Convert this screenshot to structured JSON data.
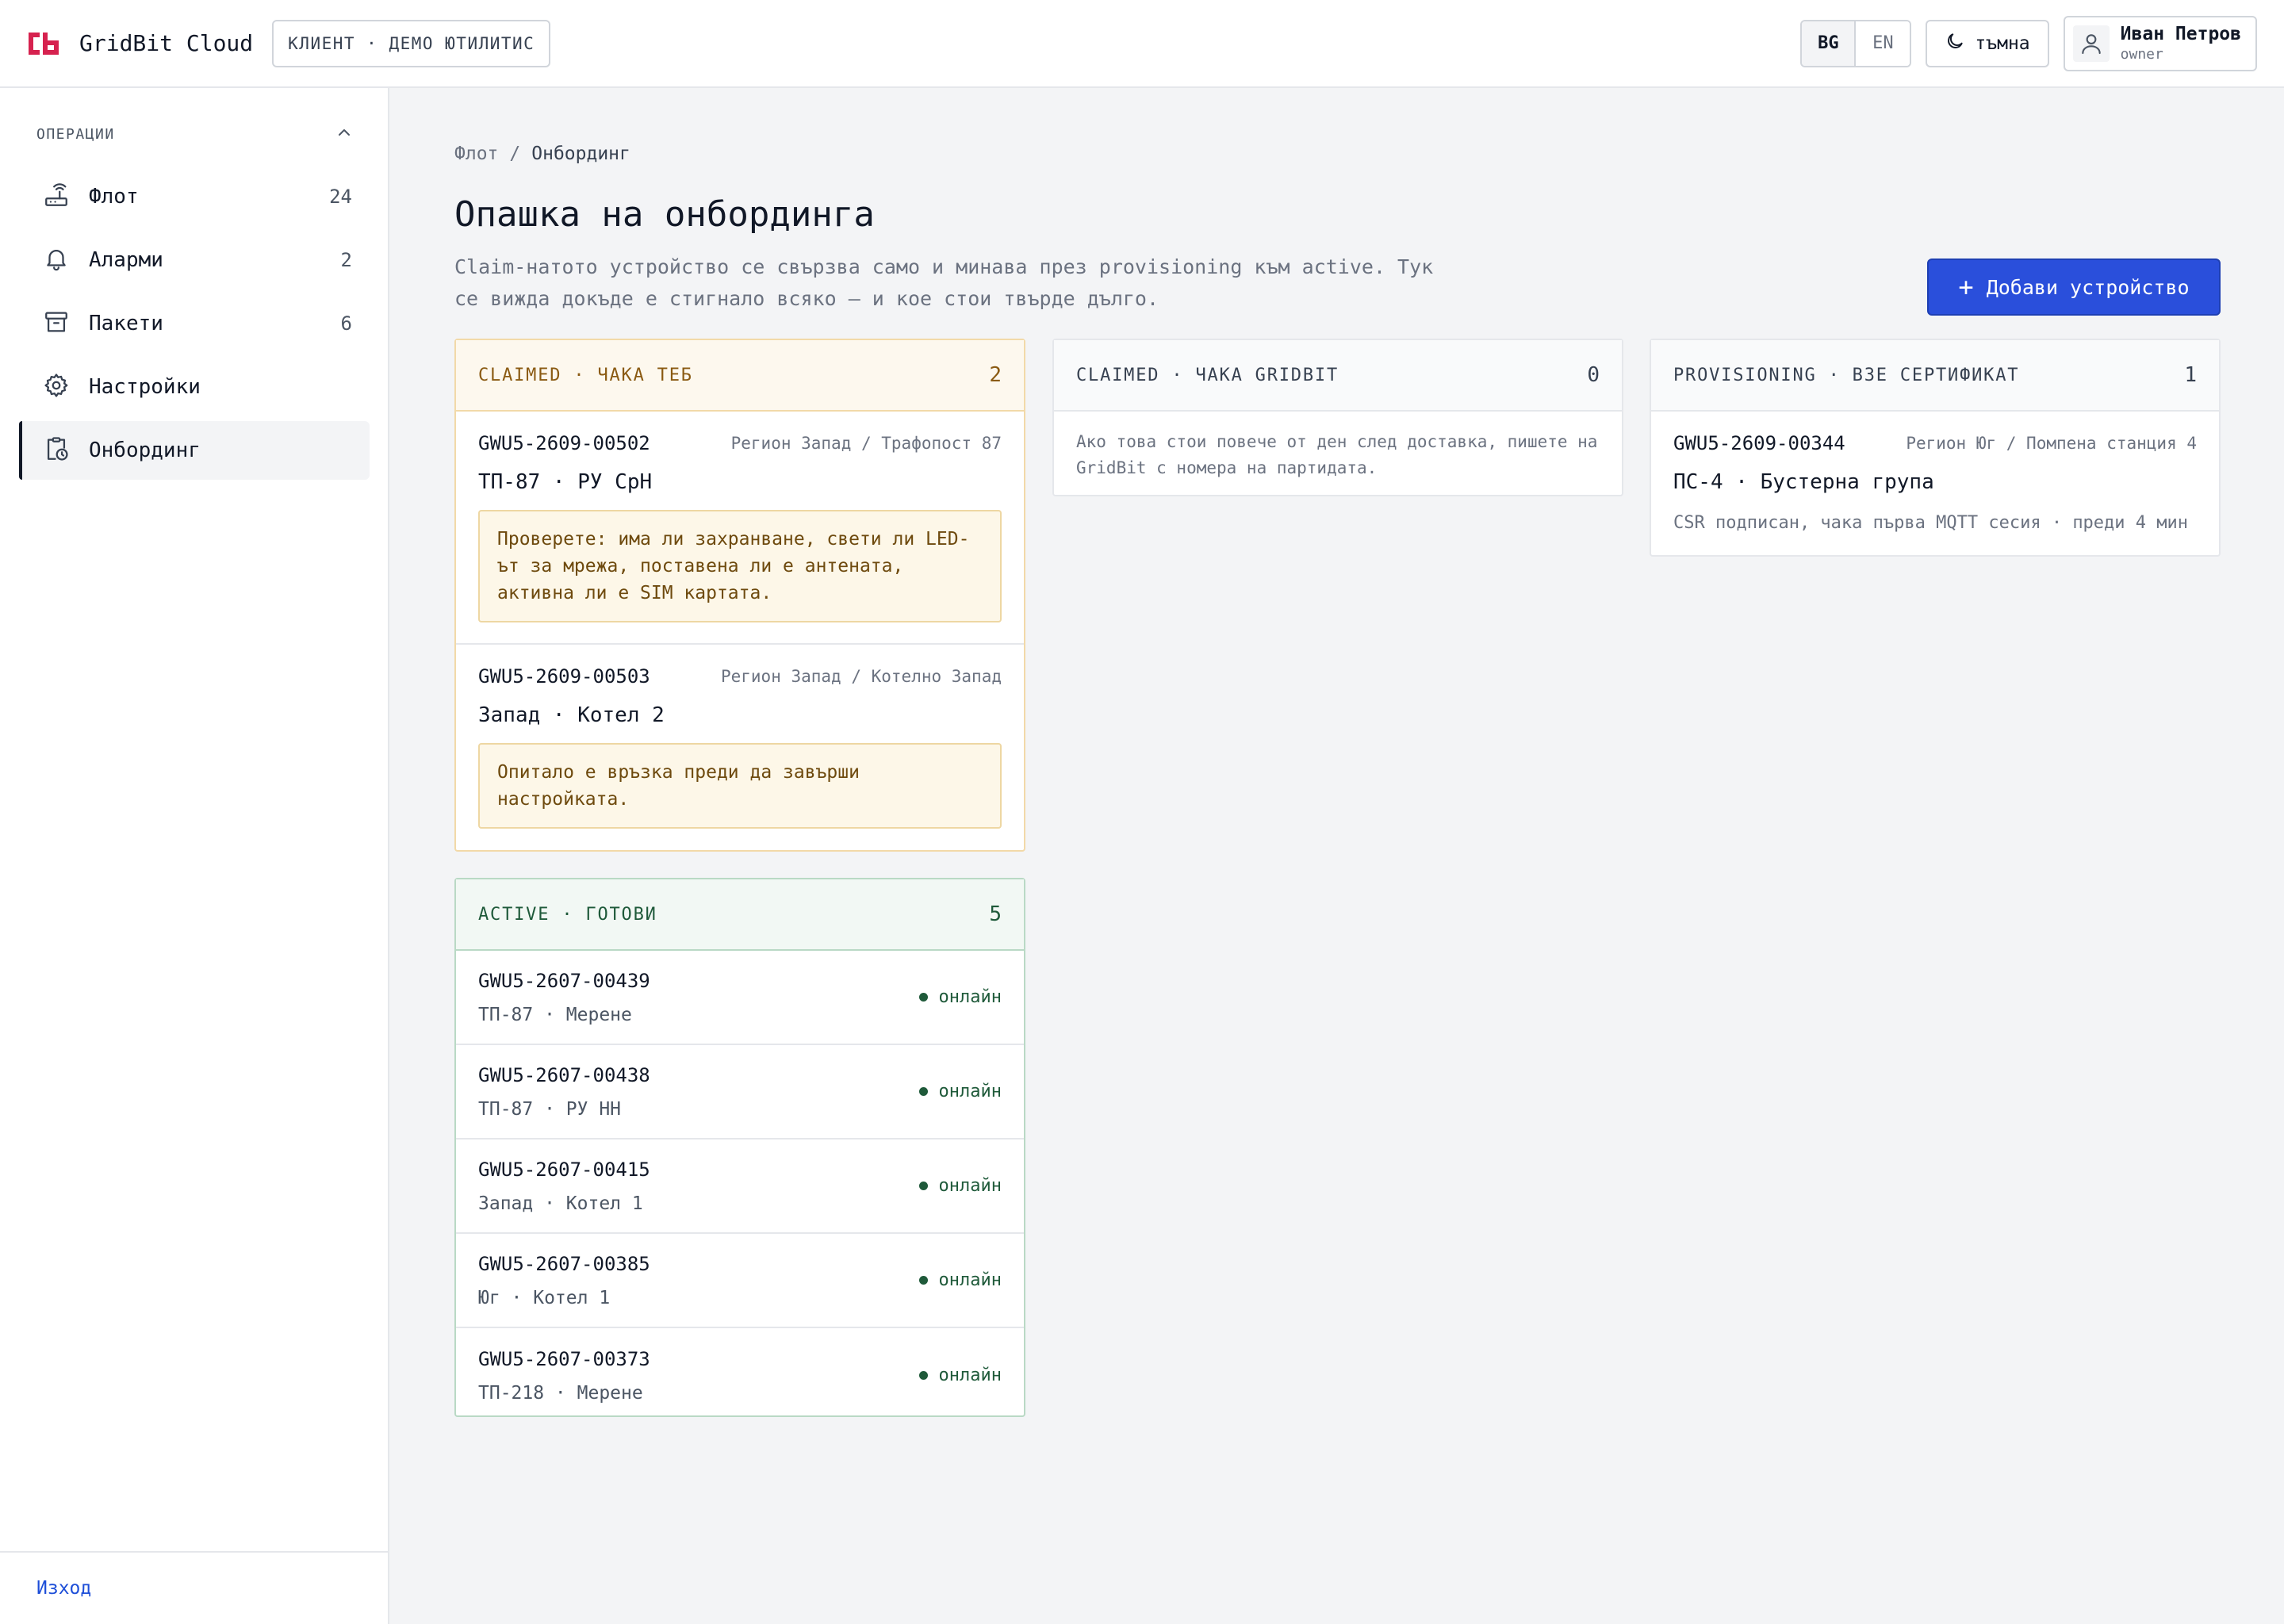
{
  "topbar": {
    "app_name": "GridBit Cloud",
    "client_chip": "КЛИЕНТ · ДЕМО ЮТИЛИТИС",
    "lang_bg": "BG",
    "lang_en": "EN",
    "theme_label": "тъмна",
    "user_name": "Иван Петров",
    "user_role": "owner",
    "brand_color": "#d6224f"
  },
  "sidebar": {
    "section_title": "ОПЕРАЦИИ",
    "items": [
      {
        "label": "Флот",
        "count": "24",
        "icon": "router-icon"
      },
      {
        "label": "Аларми",
        "count": "2",
        "icon": "bell-icon"
      },
      {
        "label": "Пакети",
        "count": "6",
        "icon": "archive-icon"
      },
      {
        "label": "Настройки",
        "count": "",
        "icon": "gear-icon"
      },
      {
        "label": "Онбординг",
        "count": "",
        "icon": "clipboard-clock-icon",
        "active": true
      }
    ],
    "logout_label": "Изход"
  },
  "main": {
    "breadcrumb": {
      "parent": "Флот",
      "separator": "/",
      "current": "Онбординг"
    },
    "title": "Опашка на онбординга",
    "description": "Claim-натото устройство се свързва само и минава през provisioning към active. Тук се вижда докъде е стигнало всяко — и кое стои твърде дълго.",
    "add_button": {
      "plus": "+",
      "label": "Добави устройство"
    },
    "claimed_you": {
      "title": "CLAIMED · ЧАКА ТЕБ",
      "count": "2",
      "cards": [
        {
          "id": "GWU5-2609-00502",
          "location": "Регион Запад / Трафопост 87",
          "name": "ТП-87 · РУ СрН",
          "note": "Проверете: има ли захранване, свети ли LED-ът за мрежа, поставена ли е антената, активна ли е SIM картата."
        },
        {
          "id": "GWU5-2609-00503",
          "location": "Регион Запад / Котелно Запад",
          "name": "Запад · Котел 2",
          "note": "Опитало е връзка преди да завърши настройката."
        }
      ]
    },
    "claimed_gridbit": {
      "title": "CLAIMED · ЧАКА GRIDBIT",
      "count": "0",
      "note": "Ако това стои повече от ден след доставка, пишете на GridBit с номера на партидата."
    },
    "provisioning": {
      "title": "PROVISIONING · ВЗЕ СЕРТИФИКАТ",
      "count": "1",
      "card": {
        "id": "GWU5-2609-00344",
        "location": "Регион Юг / Помпена станция 4",
        "name": "ПС-4 · Бустерна група",
        "status": "CSR подписан, чака първа MQTT сесия · преди 4 мин"
      }
    },
    "active": {
      "title": "ACTIVE · ГОТОВИ",
      "count": "5",
      "status_label": "онлайн",
      "rows": [
        {
          "id": "GWU5-2607-00439",
          "sub": "ТП-87 · Мерене"
        },
        {
          "id": "GWU5-2607-00438",
          "sub": "ТП-87 · РУ НН"
        },
        {
          "id": "GWU5-2607-00415",
          "sub": "Запад · Котел 1"
        },
        {
          "id": "GWU5-2607-00385",
          "sub": "Юг · Котел 1"
        },
        {
          "id": "GWU5-2607-00373",
          "sub": "ТП-218 · Мерене"
        }
      ]
    }
  },
  "colors": {
    "accent_button": "#2a4fdb",
    "warn": "#8a5a12",
    "ok": "#1f5a3a"
  }
}
